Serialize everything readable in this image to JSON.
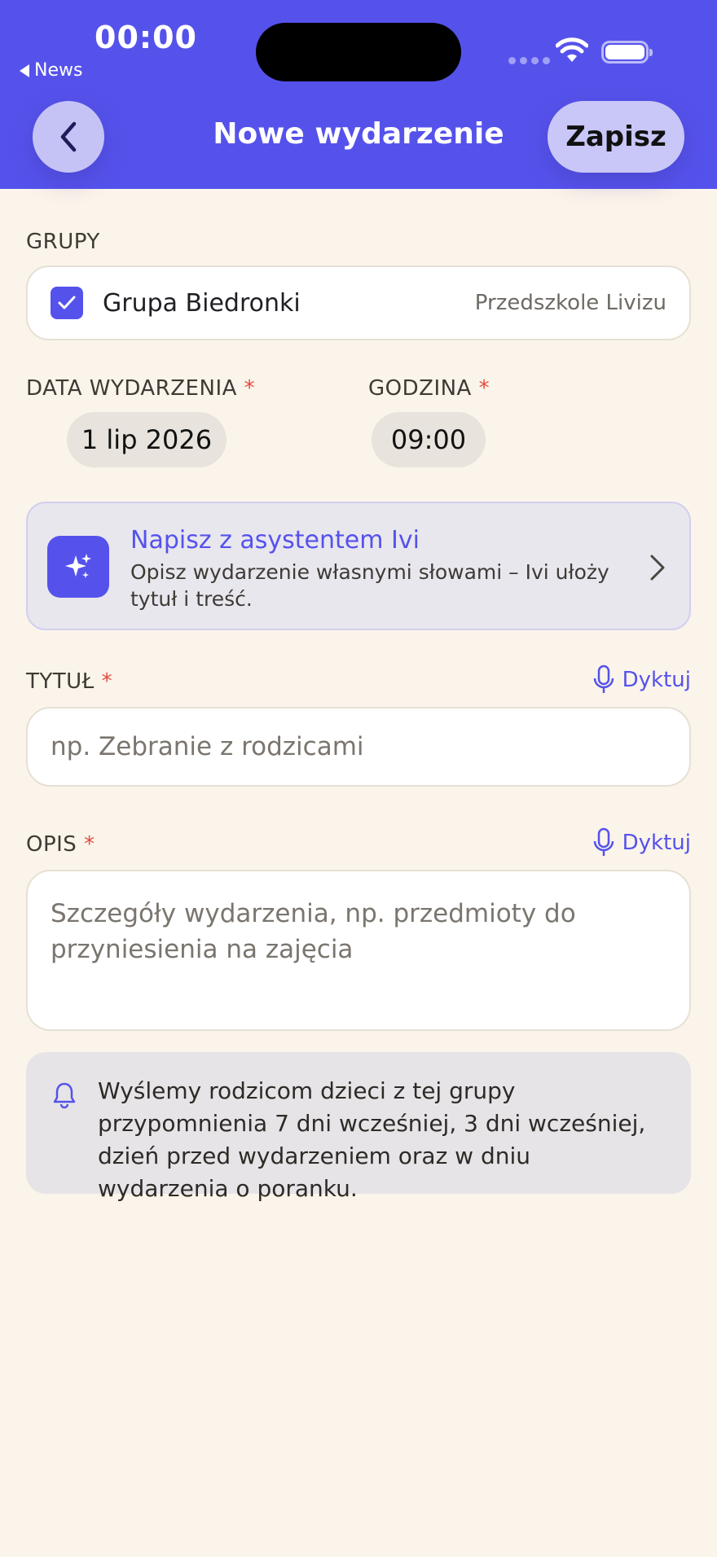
{
  "status_bar": {
    "time": "00:00",
    "back_app": "News"
  },
  "nav": {
    "title": "Nowe wydarzenie",
    "save_label": "Zapisz"
  },
  "groups": {
    "label": "GRUPY",
    "items": [
      {
        "name": "Grupa Biedronki",
        "school": "Przedszkole Livizu",
        "checked": true
      }
    ]
  },
  "date": {
    "label": "DATA WYDARZENIA",
    "required": "*",
    "value": "1 lip 2026"
  },
  "time": {
    "label": "GODZINA",
    "required": "*",
    "value": "09:00"
  },
  "assistant": {
    "title": "Napisz z asystentem Ivi",
    "description": "Opisz wydarzenie własnymi słowami – Ivi ułoży tytuł i treść.",
    "icon": "sparkles-icon"
  },
  "title_field": {
    "label": "TYTUŁ",
    "required": "*",
    "dictate_label": "Dyktuj",
    "placeholder": "np. Zebranie z rodzicami"
  },
  "description_field": {
    "label": "OPIS",
    "required": "*",
    "dictate_label": "Dyktuj",
    "placeholder": "Szczegóły wydarzenia, np. przedmioty do przyniesienia na zajęcia"
  },
  "reminder_info": {
    "text": "Wyślemy rodzicom dzieci z tej grupy przypomnienia 7 dni wcześniej, 3 dni wcześniej, dzień przed wydarzeniem oraz w dniu wydarzenia o poranku."
  },
  "colors": {
    "accent": "#5552ec",
    "background": "#fbf4ea",
    "required": "#e14b40"
  }
}
